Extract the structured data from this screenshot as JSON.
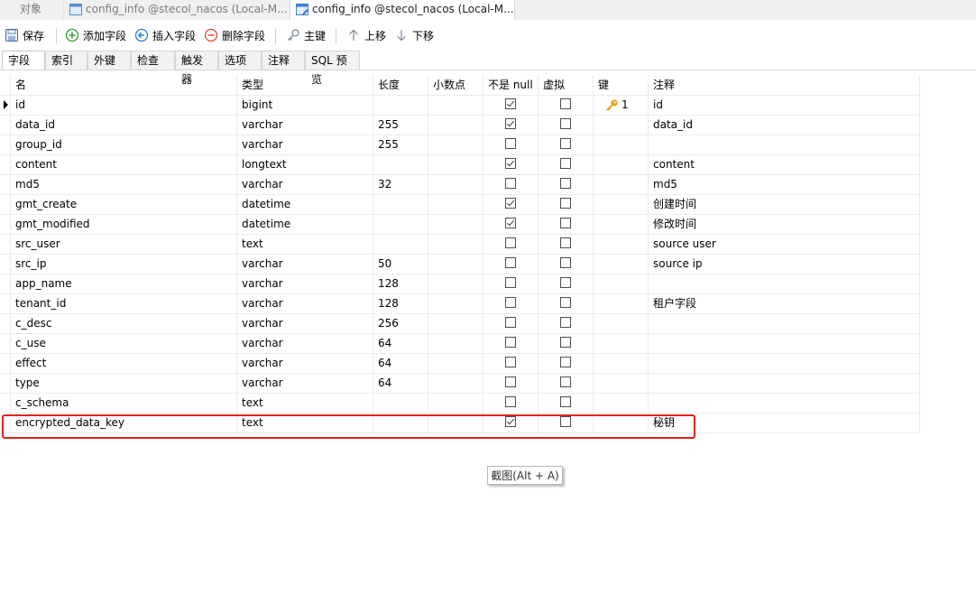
{
  "tabs": [
    {
      "label": "对象"
    },
    {
      "label": "config_info @stecol_nacos (Local-M..."
    },
    {
      "label": "config_info @stecol_nacos (Local-M..."
    }
  ],
  "toolbar": {
    "save": "保存",
    "add_field": "添加字段",
    "insert_field": "插入字段",
    "delete_field": "删除字段",
    "primary_key": "主键",
    "move_up": "上移",
    "move_down": "下移"
  },
  "subtabs": [
    "字段",
    "索引",
    "外键",
    "检查",
    "触发器",
    "选项",
    "注释",
    "SQL 预览"
  ],
  "columns": {
    "name": "名",
    "type": "类型",
    "length": "长度",
    "decimals": "小数点",
    "not_null": "不是 null",
    "virtual": "虚拟",
    "key": "键",
    "comment": "注释"
  },
  "fields": [
    {
      "name": "id",
      "type": "bigint",
      "length": "",
      "decimals": "",
      "not_null": true,
      "virtual": false,
      "key": "1",
      "comment": "id"
    },
    {
      "name": "data_id",
      "type": "varchar",
      "length": "255",
      "decimals": "",
      "not_null": true,
      "virtual": false,
      "key": "",
      "comment": "data_id"
    },
    {
      "name": "group_id",
      "type": "varchar",
      "length": "255",
      "decimals": "",
      "not_null": false,
      "virtual": false,
      "key": "",
      "comment": ""
    },
    {
      "name": "content",
      "type": "longtext",
      "length": "",
      "decimals": "",
      "not_null": true,
      "virtual": false,
      "key": "",
      "comment": "content"
    },
    {
      "name": "md5",
      "type": "varchar",
      "length": "32",
      "decimals": "",
      "not_null": false,
      "virtual": false,
      "key": "",
      "comment": "md5"
    },
    {
      "name": "gmt_create",
      "type": "datetime",
      "length": "",
      "decimals": "",
      "not_null": true,
      "virtual": false,
      "key": "",
      "comment": "创建时间"
    },
    {
      "name": "gmt_modified",
      "type": "datetime",
      "length": "",
      "decimals": "",
      "not_null": true,
      "virtual": false,
      "key": "",
      "comment": "修改时间"
    },
    {
      "name": "src_user",
      "type": "text",
      "length": "",
      "decimals": "",
      "not_null": false,
      "virtual": false,
      "key": "",
      "comment": "source user"
    },
    {
      "name": "src_ip",
      "type": "varchar",
      "length": "50",
      "decimals": "",
      "not_null": false,
      "virtual": false,
      "key": "",
      "comment": "source ip"
    },
    {
      "name": "app_name",
      "type": "varchar",
      "length": "128",
      "decimals": "",
      "not_null": false,
      "virtual": false,
      "key": "",
      "comment": ""
    },
    {
      "name": "tenant_id",
      "type": "varchar",
      "length": "128",
      "decimals": "",
      "not_null": false,
      "virtual": false,
      "key": "",
      "comment": "租户字段"
    },
    {
      "name": "c_desc",
      "type": "varchar",
      "length": "256",
      "decimals": "",
      "not_null": false,
      "virtual": false,
      "key": "",
      "comment": ""
    },
    {
      "name": "c_use",
      "type": "varchar",
      "length": "64",
      "decimals": "",
      "not_null": false,
      "virtual": false,
      "key": "",
      "comment": ""
    },
    {
      "name": "effect",
      "type": "varchar",
      "length": "64",
      "decimals": "",
      "not_null": false,
      "virtual": false,
      "key": "",
      "comment": ""
    },
    {
      "name": "type",
      "type": "varchar",
      "length": "64",
      "decimals": "",
      "not_null": false,
      "virtual": false,
      "key": "",
      "comment": ""
    },
    {
      "name": "c_schema",
      "type": "text",
      "length": "",
      "decimals": "",
      "not_null": false,
      "virtual": false,
      "key": "",
      "comment": ""
    },
    {
      "name": "encrypted_data_key",
      "type": "text",
      "length": "",
      "decimals": "",
      "not_null": true,
      "virtual": false,
      "key": "",
      "comment": "秘钥"
    }
  ],
  "tooltip": "截图(Alt + A)",
  "colors": {
    "highlight": "#e0231e",
    "key_icon": "#e3a21a",
    "add_icon": "#3a9a3a",
    "insert_icon": "#2a7bd1",
    "delete_icon": "#d94a3a"
  }
}
